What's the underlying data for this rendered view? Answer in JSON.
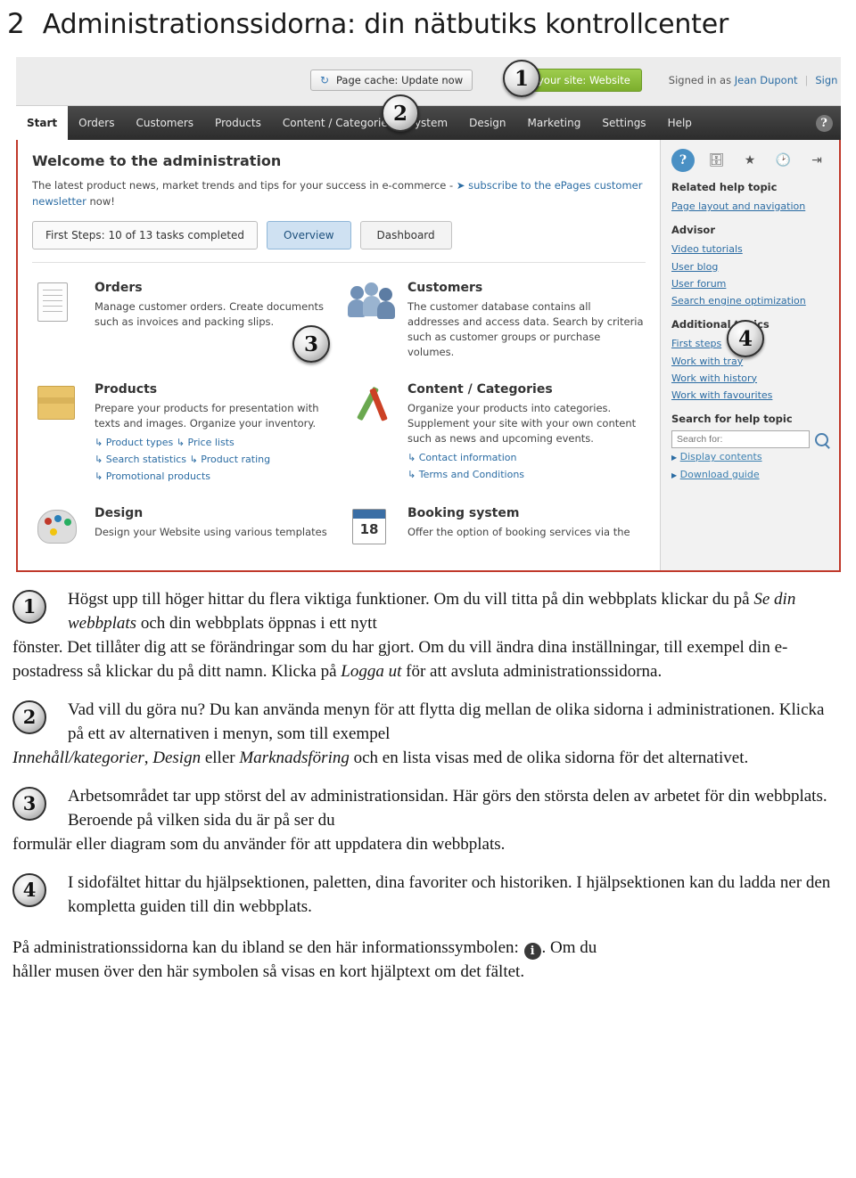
{
  "heading": {
    "number": "2",
    "text": "Administrationssidorna: din nätbutiks kontrollcenter"
  },
  "screenshot": {
    "topbar": {
      "cache_button": "Page cache: Update now",
      "cache_icon": "reload-icon",
      "site_button": "your site: Website",
      "signed_in_prefix": "Signed in as",
      "signed_in_user": "Jean Dupont",
      "sign_out": "Sign out"
    },
    "menu": {
      "items": [
        "Start",
        "Orders",
        "Customers",
        "Products",
        "Content / Categories",
        "ystem",
        "Design",
        "Marketing",
        "Settings",
        "Help"
      ],
      "active": "Start",
      "help_icon": "?"
    },
    "main": {
      "welcome_title": "Welcome to the administration",
      "news_text_1": "The latest product news, market trends and tips for your success in e-commerce -",
      "news_link": "subscribe to the ePages customer newsletter",
      "news_text_2": "now!",
      "first_steps": "First Steps: 10 of 13 tasks completed",
      "tab_overview": "Overview",
      "tab_dashboard": "Dashboard",
      "panels": [
        {
          "icon": "documents-icon",
          "title": "Orders",
          "desc": "Manage customer orders. Create documents such as invoices and packing slips.",
          "links": []
        },
        {
          "icon": "customers-icon",
          "title": "Customers",
          "desc": "The customer database contains all addresses and access data. Search by criteria such as customer groups or purchase volumes.",
          "links": []
        },
        {
          "icon": "products-box-icon",
          "title": "Products",
          "desc": "Prepare your products for presentation with texts and images. Organize your inventory.",
          "links": [
            "Product types",
            "Price lists",
            "Search statistics",
            "Product rating",
            "Promotional products"
          ]
        },
        {
          "icon": "content-pen-icon",
          "title": "Content / Categories",
          "desc": "Organize your products into categories. Supplement your site with your own content such as news and upcoming events.",
          "links": [
            "Contact information",
            "Terms and Conditions"
          ]
        },
        {
          "icon": "design-palette-icon",
          "title": "Design",
          "desc": "Design your Website using various templates",
          "links": []
        },
        {
          "icon": "booking-calendar-icon",
          "title": "Booking system",
          "desc": "Offer the option of booking services via the",
          "links": []
        }
      ]
    },
    "sidebar": {
      "icons": [
        "help-icon",
        "palette-icon",
        "star-icon",
        "clock-icon",
        "collapse-icon"
      ],
      "related_title": "Related help topic",
      "related_link": "Page layout and navigation",
      "advisor_title": "Advisor",
      "advisor_links": [
        "Video tutorials",
        "User blog",
        "User forum",
        "Search engine optimization"
      ],
      "additional_title": "Additional topics",
      "additional_links": [
        "First steps",
        "Work with tray",
        "Work with history",
        "Work with favourites"
      ],
      "search_title": "Search for help topic",
      "search_placeholder": "Search for:",
      "search_icon": "magnifier-icon",
      "search_links": [
        "Display contents",
        "Download guide"
      ]
    },
    "badges": [
      "1",
      "2",
      "3",
      "4"
    ]
  },
  "notes": [
    {
      "number": "1",
      "indented": "Högst upp till höger hittar du flera viktiga funktioner. Om du vill titta på din webbplats klickar du på ",
      "italic_1": "Se din webbplats",
      "mid_1": " och din webbplats öppnas i ett nytt ",
      "full": "fönster. Det tillåter dig att se förändringar som du har gjort. Om du vill ändra dina inställningar, till exempel din e-postadress så klickar du på ditt namn. Klicka på ",
      "italic_2": "Logga ut",
      "tail": " för att avsluta administrationssidorna."
    },
    {
      "number": "2",
      "indented": "Vad vill du göra nu? Du kan använda menyn för att flytta dig mellan de olika sidorna i administrationen. Klicka på ett av alternativen i menyn, som till exempel ",
      "italic_1": "Innehåll/kategorier",
      "mid_1": ", ",
      "italic_2": "Design",
      "mid_2": " eller ",
      "italic_3": "Marknadsföring",
      "tail": " och en lista visas med de olika sidorna för det alternativet."
    },
    {
      "number": "3",
      "indented": "Arbetsområdet tar upp störst del av administrationsidan. Här görs den största delen av arbetet för din webbplats. Beroende på vilken sida du är på ser du ",
      "tail": "formulär eller diagram som du använder för att uppdatera din webbplats."
    },
    {
      "number": "4",
      "indented": "I sidofältet hittar du hjälpsektionen, paletten, dina favoriter och historiken. I hjälpsektionen kan du ladda ner den kompletta guiden till din webbplats.",
      "tail": ""
    }
  ],
  "tail_paragraph": {
    "before": "På administrationssidorna kan du ibland se den här informationssymbolen:",
    "symbol": "i",
    "after": ". Om du",
    "second_line": "håller musen över den här symbolen så visas en kort hjälptext om det fältet."
  }
}
